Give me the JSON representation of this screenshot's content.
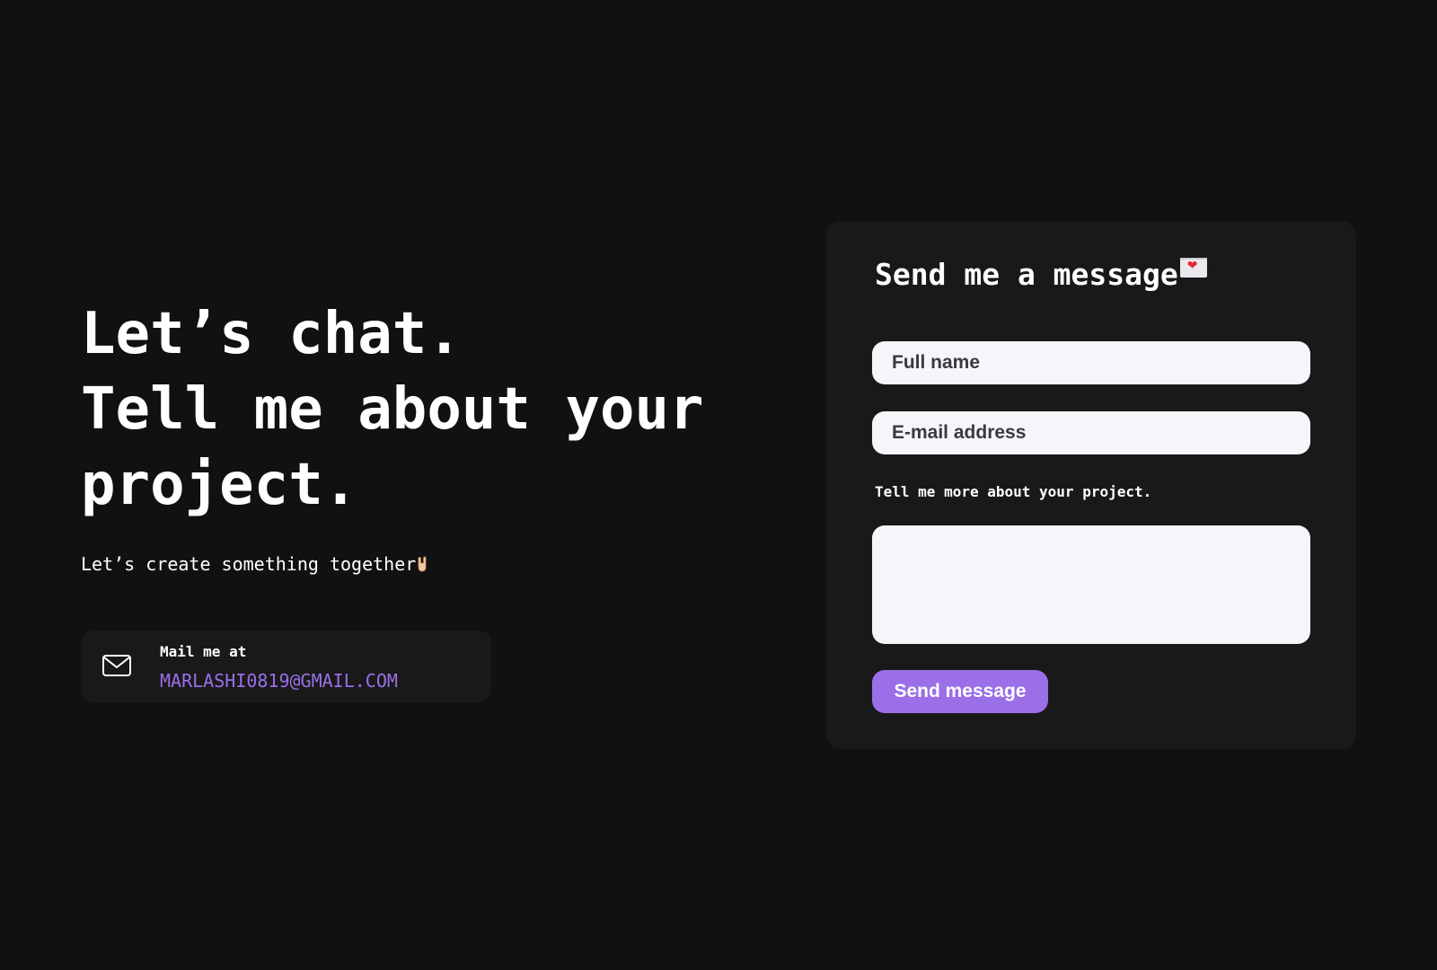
{
  "hero": {
    "title_line1": "Let’s chat.",
    "title_line2": "Tell me about your",
    "title_line3": "project.",
    "subtitle": "Let’s create something together",
    "subtitle_emoji": "rock-on-hand-icon"
  },
  "contact": {
    "icon": "mail-icon",
    "label": "Mail me at",
    "email": "MARLASHI0819@GMAIL.COM"
  },
  "form": {
    "title": "Send me a message",
    "title_emoji": "love-letter-icon",
    "name_placeholder": "Full name",
    "email_placeholder": "E-mail address",
    "message_label": "Tell me more about your project.",
    "message_value": "",
    "submit_label": "Send message"
  },
  "colors": {
    "background": "#111112",
    "card": "#19191a",
    "accent": "#9b6fe8",
    "field_bg": "#f5f5fa",
    "text": "#ffffff"
  }
}
